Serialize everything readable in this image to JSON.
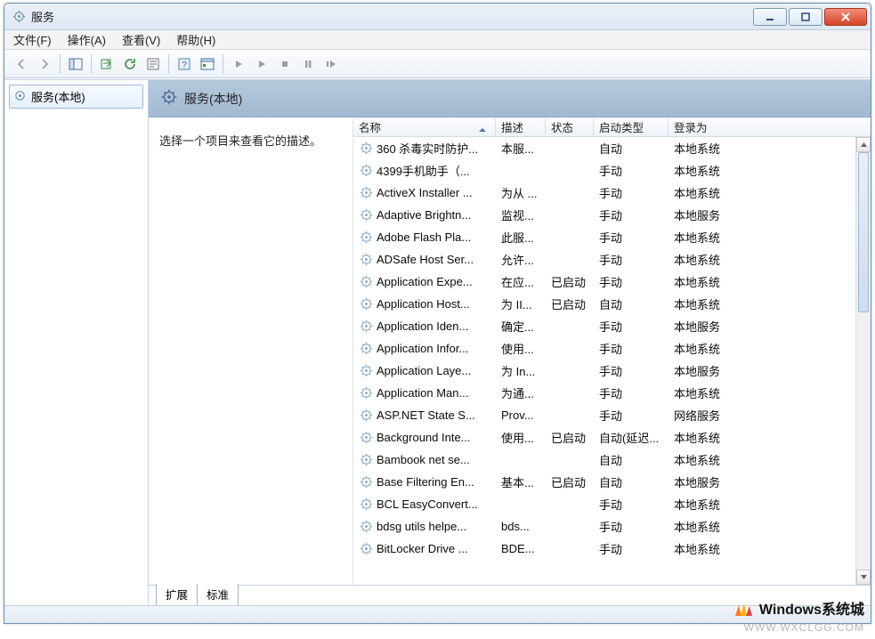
{
  "window": {
    "title": "服务"
  },
  "menu": {
    "file": "文件(F)",
    "action": "操作(A)",
    "view": "查看(V)",
    "help": "帮助(H)"
  },
  "nav": {
    "local": "服务(本地)"
  },
  "panel": {
    "heading": "服务(本地)",
    "hint": "选择一个项目来查看它的描述。"
  },
  "columns": {
    "name": "名称",
    "desc": "描述",
    "status": "状态",
    "start": "启动类型",
    "logon": "登录为"
  },
  "tabs": {
    "extended": "扩展",
    "standard": "标准"
  },
  "services": [
    {
      "name": "360 杀毒实时防护...",
      "desc": "本服...",
      "status": "",
      "start": "自动",
      "logon": "本地系统"
    },
    {
      "name": "4399手机助手（...",
      "desc": "",
      "status": "",
      "start": "手动",
      "logon": "本地系统"
    },
    {
      "name": "ActiveX Installer ...",
      "desc": "为从 ...",
      "status": "",
      "start": "手动",
      "logon": "本地系统"
    },
    {
      "name": "Adaptive Brightn...",
      "desc": "监视...",
      "status": "",
      "start": "手动",
      "logon": "本地服务"
    },
    {
      "name": "Adobe Flash Pla...",
      "desc": "此服...",
      "status": "",
      "start": "手动",
      "logon": "本地系统"
    },
    {
      "name": "ADSafe Host Ser...",
      "desc": "允许...",
      "status": "",
      "start": "手动",
      "logon": "本地系统"
    },
    {
      "name": "Application Expe...",
      "desc": "在应...",
      "status": "已启动",
      "start": "手动",
      "logon": "本地系统"
    },
    {
      "name": "Application Host...",
      "desc": "为 II...",
      "status": "已启动",
      "start": "自动",
      "logon": "本地系统"
    },
    {
      "name": "Application Iden...",
      "desc": "确定...",
      "status": "",
      "start": "手动",
      "logon": "本地服务"
    },
    {
      "name": "Application Infor...",
      "desc": "使用...",
      "status": "",
      "start": "手动",
      "logon": "本地系统"
    },
    {
      "name": "Application Laye...",
      "desc": "为 In...",
      "status": "",
      "start": "手动",
      "logon": "本地服务"
    },
    {
      "name": "Application Man...",
      "desc": "为通...",
      "status": "",
      "start": "手动",
      "logon": "本地系统"
    },
    {
      "name": "ASP.NET State S...",
      "desc": "Prov...",
      "status": "",
      "start": "手动",
      "logon": "网络服务"
    },
    {
      "name": "Background Inte...",
      "desc": "使用...",
      "status": "已启动",
      "start": "自动(延迟...",
      "logon": "本地系统"
    },
    {
      "name": "Bambook net se...",
      "desc": "",
      "status": "",
      "start": "自动",
      "logon": "本地系统"
    },
    {
      "name": "Base Filtering En...",
      "desc": "基本...",
      "status": "已启动",
      "start": "自动",
      "logon": "本地服务"
    },
    {
      "name": "BCL EasyConvert...",
      "desc": "",
      "status": "",
      "start": "手动",
      "logon": "本地系统"
    },
    {
      "name": "bdsg utils helpe...",
      "desc": "bds...",
      "status": "",
      "start": "手动",
      "logon": "本地系统"
    },
    {
      "name": "BitLocker Drive ...",
      "desc": "BDE...",
      "status": "",
      "start": "手动",
      "logon": "本地系统"
    }
  ],
  "watermark": {
    "brand": "Windows系统城",
    "url": "WWW.WXCLGG.COM"
  }
}
